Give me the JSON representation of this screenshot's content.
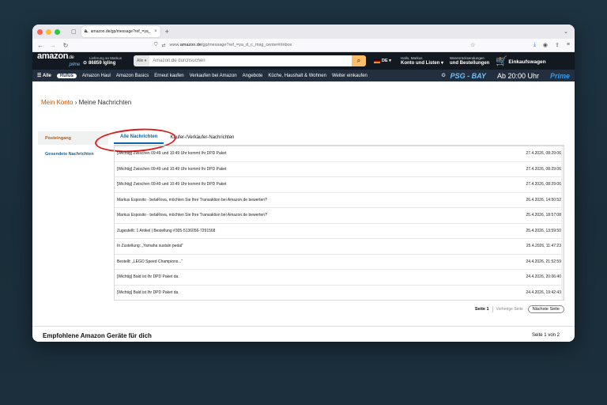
{
  "browser": {
    "tab_favicon": "a.",
    "tab_title": "amazon.de/gp/message?ref_=ya_",
    "tab_close": "×",
    "new_tab": "+",
    "url_prefix": "www.",
    "url_domain": "amazon.de",
    "url_path": "/gp/message?ref_=ya_d_c_msg_center#/inbox"
  },
  "amazon": {
    "logo": "amazon",
    "logo_tld": ".de",
    "logo_prime": "prime",
    "deliver_line1": "Lieferung an Markus",
    "deliver_line2": "86859 Igling",
    "search_category": "Alle ▾",
    "search_placeholder": "Amazon.de durchsuchen",
    "lang": "DE ▾",
    "account_line1": "Hallo, Markus",
    "account_line2": "Konto und Listen ▾",
    "orders_line1": "Warenrücksendungen",
    "orders_line2": "und Bestellungen",
    "cart_count": "0",
    "cart_label": "Einkaufswagen",
    "nav": {
      "all": "Alle",
      "rufus": "Rufus",
      "items": [
        "Amazon Haul",
        "Amazon Basics",
        "Erneut kaufen",
        "Verkaufen bei Amazon",
        "Angebote",
        "Küche, Haushalt & Wohnen",
        "Weiter einkaufen"
      ],
      "promo_match": "PSG - BAY",
      "promo_time": "Ab 20:00 Uhr",
      "promo_brand": "Prime"
    }
  },
  "page": {
    "breadcrumb_link": "Mein Konto",
    "breadcrumb_sep": "›",
    "breadcrumb_current": "Meine Nachrichten",
    "sidebar": [
      "Posteingang",
      "Gesendete Nachrichten"
    ],
    "tabs": [
      "Alle Nachrichten",
      "Käufer-/Verkäufer-Nachrichten"
    ],
    "messages": [
      {
        "subject": "[Wichtig] Zwischen 09:49 und 10:49 Uhr kommt Ihr DPD Paket",
        "date": "27.4.2026, 08:29:06"
      },
      {
        "subject": "[Wichtig] Zwischen 09:49 und 10:49 Uhr kommt Ihr DPD Paket",
        "date": "27.4.2026, 08:29:06"
      },
      {
        "subject": "[Wichtig] Zwischen 09:49 und 10:49 Uhr kommt Ihr DPD Paket",
        "date": "27.4.2026, 08:29:06"
      },
      {
        "subject": "Markus Esposito - betaRova, möchten Sie Ihre Transaktion bei Amazon.de bewerten?",
        "date": "26.4.2026, 14:50:52"
      },
      {
        "subject": "Markus Esposito - betaRova, möchten Sie Ihre Transaktion bei Amazon.de bewerten?",
        "date": "25.4.2026, 18:57:08"
      },
      {
        "subject": "Zugestellt: 1 Artikel | Bestellung #305-5136056-7291568",
        "date": "25.4.2026, 13:59:50"
      },
      {
        "subject": "In Zustellung: „Yamaha sustain pedal“",
        "date": "25.4.2026, 11:47:23"
      },
      {
        "subject": "Bestellt: „LEGO Speed Champions...“",
        "date": "24.4.2026, 21:52:59"
      },
      {
        "subject": "[Wichtig] Bald ist Ihr DPD Paket da",
        "date": "24.4.2026, 20:06:40"
      },
      {
        "subject": "[Wichtig] Bald ist Ihr DPD Paket da",
        "date": "24.4.2026, 19:42:43"
      }
    ],
    "pagination": {
      "current": "Seite 1",
      "prev": "Vorherige Seite",
      "next": "Nächste Seite"
    },
    "recommended_title": "Empfohlene Amazon Geräte für dich",
    "recommended_page": "Seite 1 von 2"
  },
  "colors": {
    "annotation": "#d91e1e",
    "amazon_dark": "#131921",
    "amazon_nav": "#232f3e",
    "link": "#0a66a8",
    "accent": "#c45500"
  },
  "icons": [
    "reload-icon",
    "shield-icon",
    "star-icon",
    "download-icon",
    "account-circle-icon",
    "share-icon",
    "menu-icon",
    "search-icon",
    "cart-icon",
    "location-pin-icon",
    "champions-league-icon"
  ]
}
